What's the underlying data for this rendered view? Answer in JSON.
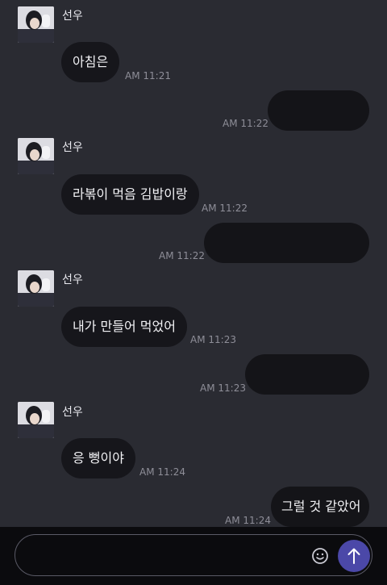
{
  "colors": {
    "background": "#2a2b32",
    "bubble": "#16161b",
    "send_button": "#4b48a8",
    "timestamp": "#8e8e98"
  },
  "messages": [
    {
      "id": "m1",
      "direction": "in",
      "sender": "선우",
      "text": "아침은",
      "time": "AM 11:21"
    },
    {
      "id": "m2",
      "direction": "out",
      "text": "",
      "redacted": true,
      "time": "AM 11:22"
    },
    {
      "id": "m3",
      "direction": "in",
      "sender": "선우",
      "text": "라볶이 먹음 김밥이랑",
      "time": "AM 11:22"
    },
    {
      "id": "m4",
      "direction": "out",
      "text": "",
      "redacted": true,
      "time": "AM 11:22"
    },
    {
      "id": "m5",
      "direction": "in",
      "sender": "선우",
      "text": "내가 만들어 먹었어",
      "time": "AM 11:23"
    },
    {
      "id": "m6",
      "direction": "out",
      "text": "",
      "redacted": true,
      "time": "AM 11:23"
    },
    {
      "id": "m7",
      "direction": "in",
      "sender": "선우",
      "text": "응 뻥이야",
      "time": "AM 11:24"
    },
    {
      "id": "m8",
      "direction": "out",
      "text": "그럴 것 같았어",
      "time": "AM 11:24"
    }
  ],
  "composer": {
    "value": "",
    "placeholder": "",
    "emoji_icon": "smiley-face-icon",
    "send_icon": "arrow-up-icon"
  }
}
